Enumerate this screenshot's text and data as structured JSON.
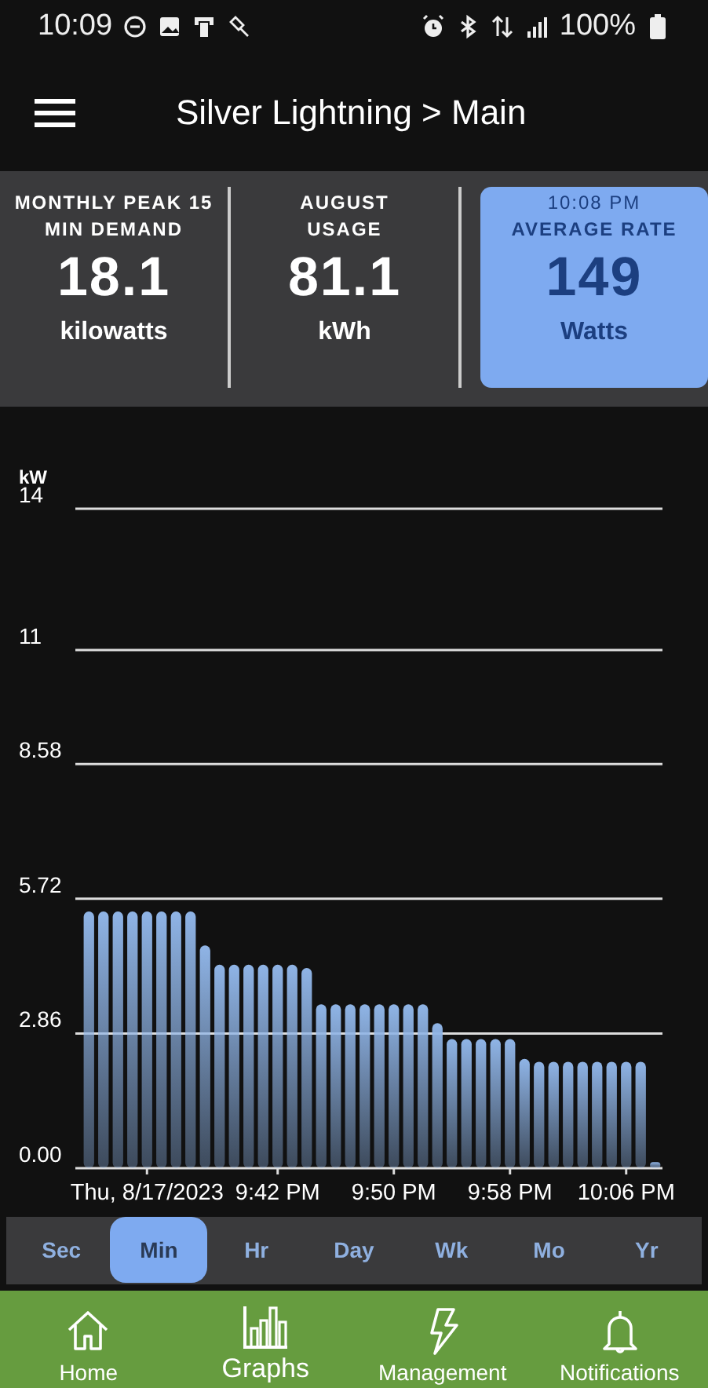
{
  "status_bar": {
    "time": "10:09",
    "battery": "100%"
  },
  "app_bar": {
    "title": "Silver Lightning > Main"
  },
  "stats": [
    {
      "label": "MONTHLY PEAK 15\nMIN DEMAND",
      "value": "18.1",
      "unit": "kilowatts",
      "highlighted": false
    },
    {
      "label": "AUGUST\nUSAGE",
      "value": "81.1",
      "unit": "kWh",
      "highlighted": false
    },
    {
      "time": "10:08 PM",
      "label": "AVERAGE RATE",
      "value": "149",
      "unit": "Watts",
      "highlighted": true
    }
  ],
  "graph": {
    "chart_data": {
      "type": "bar",
      "ylabel": "kW",
      "categories": [
        null,
        null,
        null,
        null,
        "Thu, 8/17/2023",
        null,
        null,
        null,
        null,
        null,
        null,
        null,
        null,
        "9:42 PM",
        null,
        null,
        null,
        null,
        null,
        null,
        null,
        "9:50 PM",
        null,
        null,
        null,
        null,
        null,
        null,
        null,
        "9:58 PM",
        null,
        null,
        null,
        null,
        null,
        null,
        null,
        "10:06 PM",
        null,
        null
      ],
      "series": [
        {
          "color": "#8fb4e6",
          "values": [
            5.45,
            5.45,
            5.45,
            5.45,
            5.45,
            5.45,
            5.45,
            5.45,
            4.73,
            4.32,
            4.32,
            4.32,
            4.32,
            4.32,
            4.32,
            4.25,
            3.48,
            3.48,
            3.48,
            3.48,
            3.48,
            3.48,
            3.48,
            3.48,
            3.08,
            2.74,
            2.74,
            2.74,
            2.74,
            2.74,
            2.32,
            2.26,
            2.26,
            2.26,
            2.26,
            2.26,
            2.26,
            2.26,
            2.26,
            0.13
          ]
        }
      ],
      "grid": true,
      "ylim": [
        0,
        14
      ],
      "yticks": [
        {
          "value": 0,
          "label": "0.00"
        },
        2.86,
        5.72,
        8.58,
        11,
        14
      ]
    }
  },
  "periods": [
    {
      "label": "Sec",
      "selected": false
    },
    {
      "label": "Min",
      "selected": true
    },
    {
      "label": "Hr",
      "selected": false
    },
    {
      "label": "Day",
      "selected": false
    },
    {
      "label": "Wk",
      "selected": false
    },
    {
      "label": "Mo",
      "selected": false
    },
    {
      "label": "Yr",
      "selected": false
    }
  ],
  "bottom_nav": [
    {
      "kind": "home",
      "label": "Home",
      "selected": false
    },
    {
      "kind": "graphs",
      "label": "Graphs",
      "selected": true
    },
    {
      "kind": "bolt",
      "label": "Management",
      "selected": false
    },
    {
      "kind": "bell",
      "label": "Notifications",
      "selected": false
    }
  ]
}
